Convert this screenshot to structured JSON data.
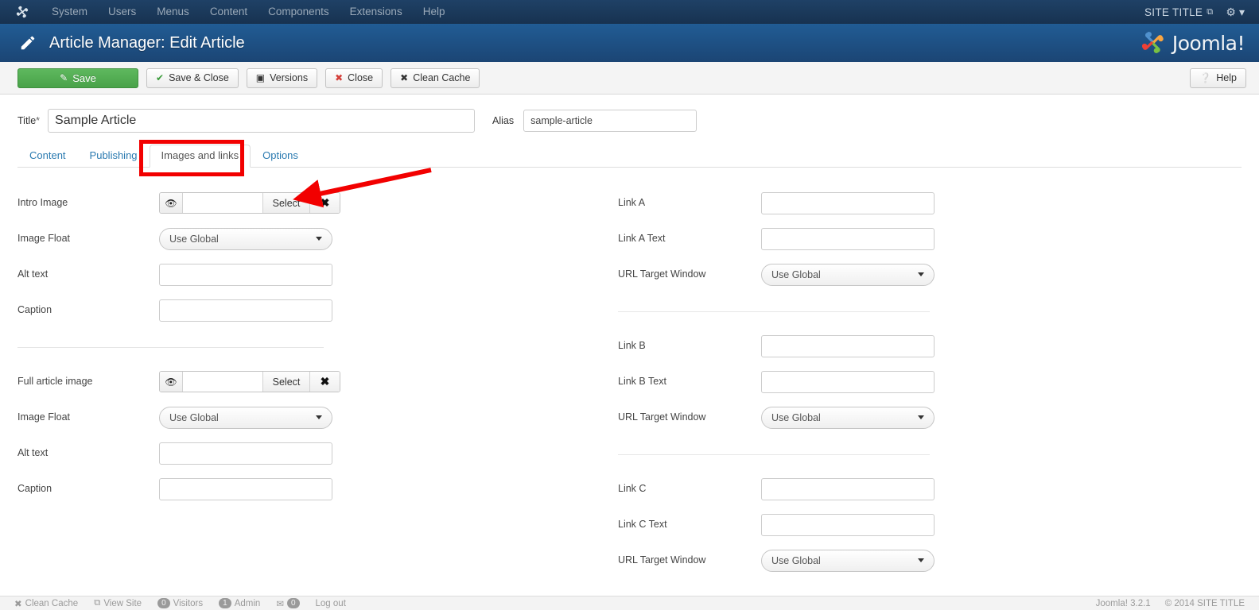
{
  "topbar": {
    "logo_icon": "joomla-logo-icon",
    "menu": [
      {
        "label": "System"
      },
      {
        "label": "Users"
      },
      {
        "label": "Menus"
      },
      {
        "label": "Content"
      },
      {
        "label": "Components"
      },
      {
        "label": "Extensions"
      },
      {
        "label": "Help"
      }
    ],
    "site_title": "SITE TITLE",
    "external_icon": "external-link-icon",
    "gear_icon": "gear-icon",
    "gear_caret": "▾"
  },
  "header": {
    "icon": "pencil-icon",
    "title": "Article Manager: Edit Article",
    "brand": "Joomla!"
  },
  "toolbar": {
    "save": "Save",
    "save_close": "Save & Close",
    "versions": "Versions",
    "close": "Close",
    "clean_cache": "Clean Cache",
    "help": "Help"
  },
  "form": {
    "title_label": "Title",
    "title_required": "*",
    "title_value": "Sample Article",
    "alias_label": "Alias",
    "alias_value": "sample-article"
  },
  "tabs": [
    {
      "label": "Content",
      "active": false
    },
    {
      "label": "Publishing",
      "active": false
    },
    {
      "label": "Images and links",
      "active": true
    },
    {
      "label": "Options",
      "active": false
    }
  ],
  "left_column": {
    "intro": {
      "image_label": "Intro Image",
      "image_value": "",
      "eye_icon": "eye-icon",
      "select_label": "Select",
      "clear_icon": "x-close-icon",
      "float_label": "Image Float",
      "float_value": "Use Global",
      "alt_label": "Alt text",
      "alt_value": "",
      "caption_label": "Caption",
      "caption_value": ""
    },
    "full": {
      "image_label": "Full article image",
      "image_value": "",
      "eye_icon": "eye-icon",
      "select_label": "Select",
      "clear_icon": "x-close-icon",
      "float_label": "Image Float",
      "float_value": "Use Global",
      "alt_label": "Alt text",
      "alt_value": "",
      "caption_label": "Caption",
      "caption_value": ""
    }
  },
  "right_column": {
    "link_a": {
      "link_label": "Link A",
      "link_value": "",
      "text_label": "Link A Text",
      "text_value": "",
      "target_label": "URL Target Window",
      "target_value": "Use Global"
    },
    "link_b": {
      "link_label": "Link B",
      "link_value": "",
      "text_label": "Link B Text",
      "text_value": "",
      "target_label": "URL Target Window",
      "target_value": "Use Global"
    },
    "link_c": {
      "link_label": "Link C",
      "link_value": "",
      "text_label": "Link C Text",
      "text_value": "",
      "target_label": "URL Target Window",
      "target_value": "Use Global"
    }
  },
  "annotations": {
    "highlight_target": "Images and links",
    "arrow_target": "Select",
    "color": "#f20000"
  },
  "footer": {
    "clean_cache": "Clean Cache",
    "view_site": "View Site",
    "visitors_count": "0",
    "visitors": "Visitors",
    "admin_count": "1",
    "admin": "Admin",
    "messages_count": "0",
    "log_out": "Log out",
    "version": "Joomla! 3.2.1",
    "copyright": "© 2014 SITE TITLE"
  }
}
